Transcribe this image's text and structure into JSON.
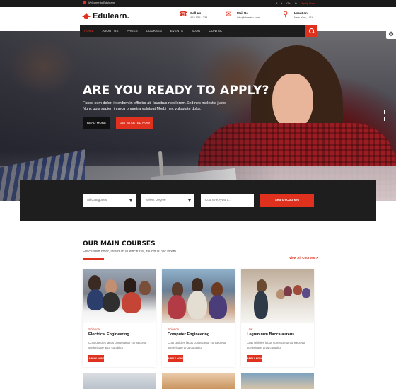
{
  "topbar": {
    "welcome": "Welcome to Edulearn",
    "socials": [
      "f",
      "t",
      "G+",
      "in"
    ],
    "apply_link": "Apply Now"
  },
  "header": {
    "logo_text": "Edulearn.",
    "call": {
      "title": "Call Us",
      "value": "415 555 1234"
    },
    "mail": {
      "title": "Mail Us",
      "value": "info@domain.com"
    },
    "location": {
      "title": "Location",
      "value": "New York, USA"
    }
  },
  "nav": {
    "items": [
      "HOME",
      "ABOUT US",
      "PAGES",
      "COURSES",
      "EVENTS",
      "BLOG",
      "CONTACT"
    ],
    "active": "HOME"
  },
  "hero": {
    "title": "ARE YOU READY TO APPLY?",
    "subtitle": "Fusce sem dolor, interdum in efficitur at, faucibus nec lorem.Sed nec molestie justo. Nunc quis sapien in arcu pharetra volutpat.Morbi nec vulputate dolor.",
    "read_more": "READ MORE",
    "get_started": "GET STARTED NOW"
  },
  "search": {
    "categories": "All Categories",
    "degree": "Select Degree",
    "keyword_placeholder": "Course Keyword...",
    "button": "Search Courses"
  },
  "courses": {
    "title": "OUR MAIN COURSES",
    "subtitle": "Fusce sem dolor, interdum in efficitur at, faucibus nec lorem.",
    "view_all": "View All Courses >",
    "items": [
      {
        "category": "Science",
        "title": "Electrical Engineering",
        "desc": "Cras ultricies lacus consectetur consectetur scelerisque arcu curabitur",
        "apply": "APPLY NOW"
      },
      {
        "category": "Science",
        "title": "Computer Engineering",
        "desc": "Cras ultricies lacus consectetur consectetur scelerisque arcu curabitur",
        "apply": "APPLY NOW"
      },
      {
        "category": "Law",
        "title": "Legum nrm Baccalaureus",
        "desc": "Cras ultricies lacus consectetur consectetur scelerisque arcu curabitur",
        "apply": "APPLY NOW"
      }
    ]
  },
  "colors": {
    "accent": "#e0301e",
    "dark": "#1e1e1e"
  }
}
